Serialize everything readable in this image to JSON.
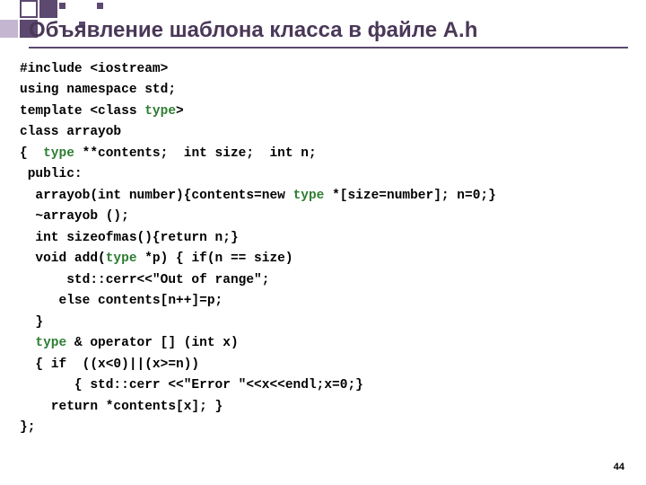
{
  "title": "Объявление шаблона класса в файле A.h",
  "pageNumber": "44",
  "code": {
    "l1a": "#include <iostream>",
    "l2a": "using namespace std;",
    "l3a": "template <class ",
    "l3b": "type",
    "l3c": ">",
    "l4a": "class arrayob",
    "l5a": "{  ",
    "l5b": "type",
    "l5c": " **contents;  int size;  int n;",
    "l6a": " public:",
    "l7a": "  arrayob(int number){contents=new ",
    "l7b": "type",
    "l7c": " *[size=number]; n=0;}",
    "l8a": "  ~arrayob ();",
    "l9a": "  int sizeofmas(){return n;}",
    "l10a": "  void add(",
    "l10b": "type",
    "l10c": " *p) { if(n == size)",
    "l11a": "      std::cerr<<\"Out of range\";",
    "l12a": "     else contents[n++]=p;",
    "l13a": "  }",
    "l14a": "  ",
    "l14b": "type",
    "l14c": " & operator [] (int x)",
    "l15a": "  { if  ((x<0)||(x>=n))",
    "l16a": "       { std::cerr <<\"Error \"<<x<<endl;x=0;}",
    "l17a": "    return *contents[x]; }",
    "l18a": "};"
  }
}
